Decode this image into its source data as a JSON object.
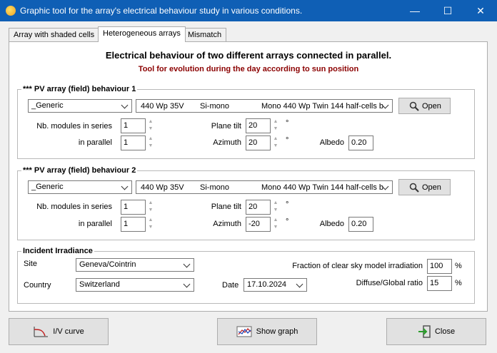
{
  "window": {
    "title": "Graphic tool for the array's electrical behaviour study in various conditions.",
    "minimize": "—",
    "maximize": "☐",
    "close": "✕"
  },
  "tabs": [
    {
      "label": "Array with shaded cells",
      "active": false
    },
    {
      "label": "Heterogeneous arrays",
      "active": true
    },
    {
      "label": "Mismatch",
      "active": false
    }
  ],
  "heading": "Electrical behaviour of two different arrays connected in parallel.",
  "subheading": "Tool for evolution during the day according to sun position",
  "arrays": [
    {
      "legend": "*** PV array (field) behaviour 1",
      "manufacturer": "_Generic",
      "module": {
        "power": "440 Wp 35V",
        "tech": "Si-mono",
        "model": "Mono 440 Wp Twin 144 half-cells b"
      },
      "open_label": "Open",
      "series_label": "Nb. modules in series",
      "series_value": "1",
      "parallel_label": "in parallel",
      "parallel_value": "1",
      "tilt_label": "Plane tilt",
      "tilt_value": "20",
      "azimuth_label": "Azimuth",
      "azimuth_value": "20",
      "albedo_label": "Albedo",
      "albedo_value": "0.20",
      "degree": "°"
    },
    {
      "legend": "*** PV array (field) behaviour 2",
      "manufacturer": "_Generic",
      "module": {
        "power": "440 Wp 35V",
        "tech": "Si-mono",
        "model": "Mono 440 Wp Twin 144 half-cells b"
      },
      "open_label": "Open",
      "series_label": "Nb. modules in series",
      "series_value": "1",
      "parallel_label": "in parallel",
      "parallel_value": "1",
      "tilt_label": "Plane tilt",
      "tilt_value": "20",
      "azimuth_label": "Azimuth",
      "azimuth_value": "-20",
      "albedo_label": "Albedo",
      "albedo_value": "0.20",
      "degree": "°"
    }
  ],
  "irradiance": {
    "legend": "Incident Irradiance",
    "site_label": "Site",
    "site_value": "Geneva/Cointrin",
    "country_label": "Country",
    "country_value": "Switzerland",
    "date_label": "Date",
    "date_value": "17.10.2024",
    "clear_sky_label": "Fraction of clear sky model irradiation",
    "clear_sky_value": "100",
    "diffuse_label": "Diffuse/Global ratio",
    "diffuse_value": "15",
    "percent": "%"
  },
  "buttons": {
    "iv_curve": "I/V curve",
    "show_graph": "Show graph",
    "close": "Close"
  }
}
